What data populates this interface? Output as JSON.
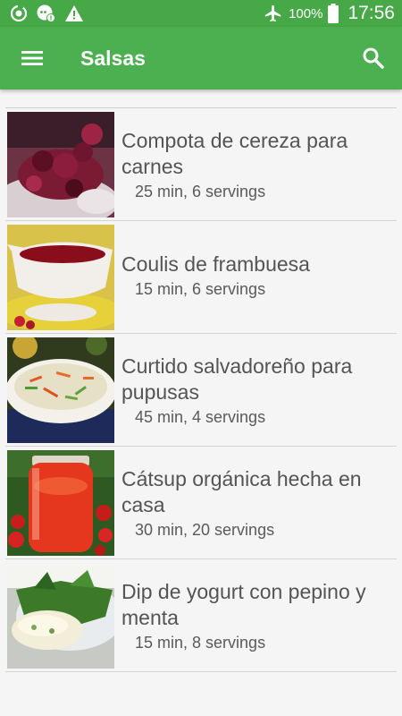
{
  "status_bar": {
    "battery": "100%",
    "time": "17:56",
    "left_icons": [
      "sync-icon",
      "chat-bubble-icon",
      "warning-icon"
    ],
    "right_icons": [
      "airplane-mode-icon",
      "battery-icon"
    ]
  },
  "app_bar": {
    "title": "Salsas",
    "menu_icon": "hamburger-menu-icon",
    "search_icon": "search-icon"
  },
  "recipes": [
    {
      "title": "Compota de cereza para carnes",
      "meta": "25 min, 6 servings"
    },
    {
      "title": "Coulis de frambuesa",
      "meta": "15 min, 6 servings"
    },
    {
      "title": "Curtido salvadoreño para pupusas",
      "meta": "45 min, 4 servings"
    },
    {
      "title": "Cátsup orgánica hecha en casa",
      "meta": "30 min, 20 servings"
    },
    {
      "title": "Dip de yogurt con pepino y menta",
      "meta": "15 min, 8 servings"
    }
  ],
  "colors": {
    "status_bar": "#47a847",
    "app_bar": "#4caf50",
    "background": "#f5f5f5",
    "text": "#545454"
  }
}
